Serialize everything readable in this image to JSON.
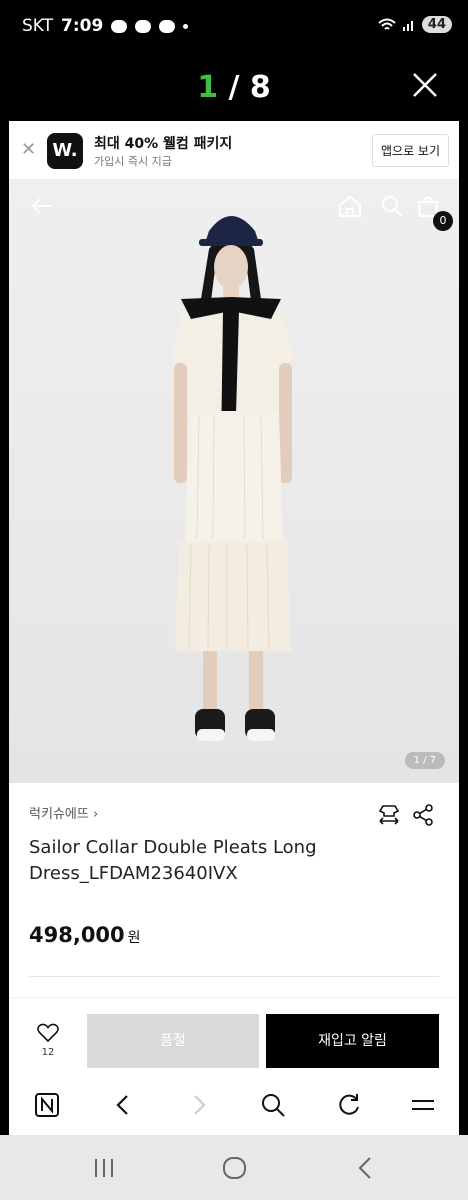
{
  "status_bar": {
    "carrier": "SKT",
    "time": "7:09",
    "battery": "44"
  },
  "viewer": {
    "current": "1",
    "separator": " / ",
    "total": "8"
  },
  "banner": {
    "logo": "W.",
    "title": "최대 40% 웰컴 패키지",
    "subtitle": "가입시 즉시 지급",
    "app_button": "앱으로 보기"
  },
  "header": {
    "cart_count": "0"
  },
  "gallery": {
    "indicator": "1 / 7"
  },
  "product": {
    "brand": "럭키슈에뜨",
    "name": "Sailor Collar Double Pleats Long Dress_LFDAM23640IVX",
    "price": "498,000",
    "currency": "원",
    "likes": "12"
  },
  "actions": {
    "sold_out": "품절",
    "restock_alert": "재입고 알림"
  },
  "icons": {
    "close": "close-icon",
    "back": "arrow-left-icon",
    "home": "home-icon",
    "search": "search-icon",
    "cart": "bag-icon",
    "fit": "size-icon",
    "share": "share-icon",
    "heart": "heart-icon"
  }
}
